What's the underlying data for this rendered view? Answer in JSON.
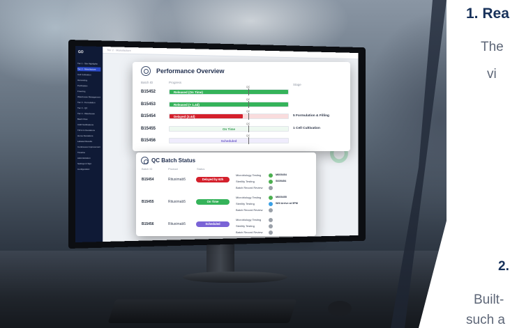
{
  "sidebar": {
    "logo": "GO",
    "items": [
      {
        "label": "Tier 1 - Site Highlights",
        "active": false
      },
      {
        "label": "Tier 2 - Manufacture",
        "active": true
      },
      {
        "label": "Cell Cultivation",
        "active": false
      },
      {
        "label": "Harvesting",
        "active": false
      },
      {
        "label": "Purification",
        "active": false
      },
      {
        "label": "Freezing",
        "active": false
      },
      {
        "label": "Warehouse Management",
        "active": false
      },
      {
        "label": "Tier 3 - Formulation",
        "active": false
      },
      {
        "label": "Tier 3 - QC",
        "active": false
      },
      {
        "label": "Tier 4 - Warehouse",
        "active": false
      },
      {
        "label": "Batch Flow",
        "active": false
      },
      {
        "label": "CAR Notifications",
        "active": false
      },
      {
        "label": "TW & G Deviations",
        "active": false
      },
      {
        "label": "Home Deviations",
        "active": false
      },
      {
        "label": "Labeled Results",
        "active": false
      },
      {
        "label": "Continuous Improvement",
        "active": false
      },
      {
        "label": "Timeline",
        "active": false
      },
      {
        "label": "Administration",
        "active": false
      },
      {
        "label": "Settings & Sign",
        "active": false
      },
      {
        "label": "Configuration",
        "active": false
      }
    ]
  },
  "topbar": {
    "crumb": "Tier 2 · Manufacture"
  },
  "performance": {
    "title": "Performance Overview",
    "col_batch": "Batch ID",
    "col_progress": "Progress",
    "col_stage": "Stage",
    "qc_label": "QC",
    "rows": [
      {
        "id": "B15452",
        "label": "Released (On Time)",
        "color": "#35b35a",
        "fill": 1.0,
        "label_color": "#ffffff",
        "track": "#e6f6ea",
        "stage": ""
      },
      {
        "id": "B15453",
        "label": "Released (+ 1.4d)",
        "color": "#35b35a",
        "fill": 1.0,
        "label_color": "#ffffff",
        "track": "#e6f6ea",
        "stage": ""
      },
      {
        "id": "B15454",
        "label": "Delayed (3.4d)",
        "color": "#d4202c",
        "fill": 0.62,
        "label_color": "#ffffff",
        "track": "#f9dcdd",
        "stage": "5 Formulation & Filling"
      },
      {
        "id": "B15455",
        "label": "On Time",
        "color": "#e3f5e8",
        "fill": 0.0,
        "label_color": "#2f9a4d",
        "track": "#eef9f1",
        "stage": "1 Cell Cultivation"
      },
      {
        "id": "B15456",
        "label": "Scheduled",
        "color": "#ece8fb",
        "fill": 0.0,
        "label_color": "#6e5cc9",
        "track": "#efecfc",
        "stage": ""
      }
    ]
  },
  "qc": {
    "title": "QC Batch Status",
    "col_batch": "Batch ID",
    "col_product": "Product",
    "col_status": "Status",
    "rows": [
      {
        "id": "B15454",
        "product": "Rituximab5",
        "status": "Delayed by 62h",
        "status_color": "#d4202c",
        "tests": [
          {
            "name": "Microbiology Testing",
            "dot": "#4caf50",
            "note": "M605454"
          },
          {
            "name": "Sterility Testing",
            "dot": "#4caf50",
            "note": "S605454"
          },
          {
            "name": "Batch Record Review",
            "dot": "#9aa0a8",
            "note": ""
          }
        ]
      },
      {
        "id": "B15455",
        "product": "Rituximab5",
        "status": "On Time",
        "status_color": "#35b35a",
        "tests": [
          {
            "name": "Microbiology Testing",
            "dot": "#4caf50",
            "note": "M605455"
          },
          {
            "name": "Sterility Testing",
            "dot": "#3aa0e6",
            "note": "Will Arrive at 5PM"
          },
          {
            "name": "Batch Record Review",
            "dot": "#9aa0a8",
            "note": ""
          }
        ]
      },
      {
        "id": "B15456",
        "product": "Rituximab5",
        "status": "Scheduled",
        "status_color": "#7a63d6",
        "tests": [
          {
            "name": "Microbiology Testing",
            "dot": "#9aa0a8",
            "note": ""
          },
          {
            "name": "Sterility Testing",
            "dot": "#9aa0a8",
            "note": ""
          },
          {
            "name": "Batch Record Review",
            "dot": "#9aa0a8",
            "note": ""
          }
        ]
      }
    ]
  },
  "marketing": {
    "heading1": "1. Rea",
    "line1": "The",
    "line2": "vi",
    "heading2": "2.",
    "line3": "Built-",
    "line4": "such a"
  }
}
